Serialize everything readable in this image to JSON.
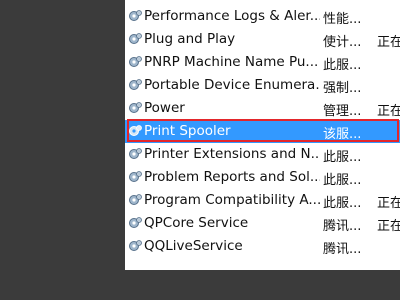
{
  "services": [
    {
      "name": "Performance Logs & Aler...",
      "description": "性能...",
      "status": ""
    },
    {
      "name": "Plug and Play",
      "description": "使计...",
      "status": "正在"
    },
    {
      "name": "PNRP Machine Name Pu...",
      "description": "此服...",
      "status": ""
    },
    {
      "name": "Portable Device Enumera...",
      "description": "强制...",
      "status": ""
    },
    {
      "name": "Power",
      "description": "管理...",
      "status": "正在"
    },
    {
      "name": "Print Spooler",
      "description": "该服...",
      "status": "",
      "selected": true
    },
    {
      "name": "Printer Extensions and N...",
      "description": "此服...",
      "status": ""
    },
    {
      "name": "Problem Reports and Sol...",
      "description": "此服...",
      "status": ""
    },
    {
      "name": "Program Compatibility A...",
      "description": "此服...",
      "status": "正在"
    },
    {
      "name": "QPCore Service",
      "description": "腾讯...",
      "status": "正在"
    },
    {
      "name": "QQLiveService",
      "description": "腾讯...",
      "status": ""
    }
  ],
  "colors": {
    "selection": "#3399ff",
    "highlight_outline": "#e3262b"
  },
  "icon": "gear-service-icon"
}
